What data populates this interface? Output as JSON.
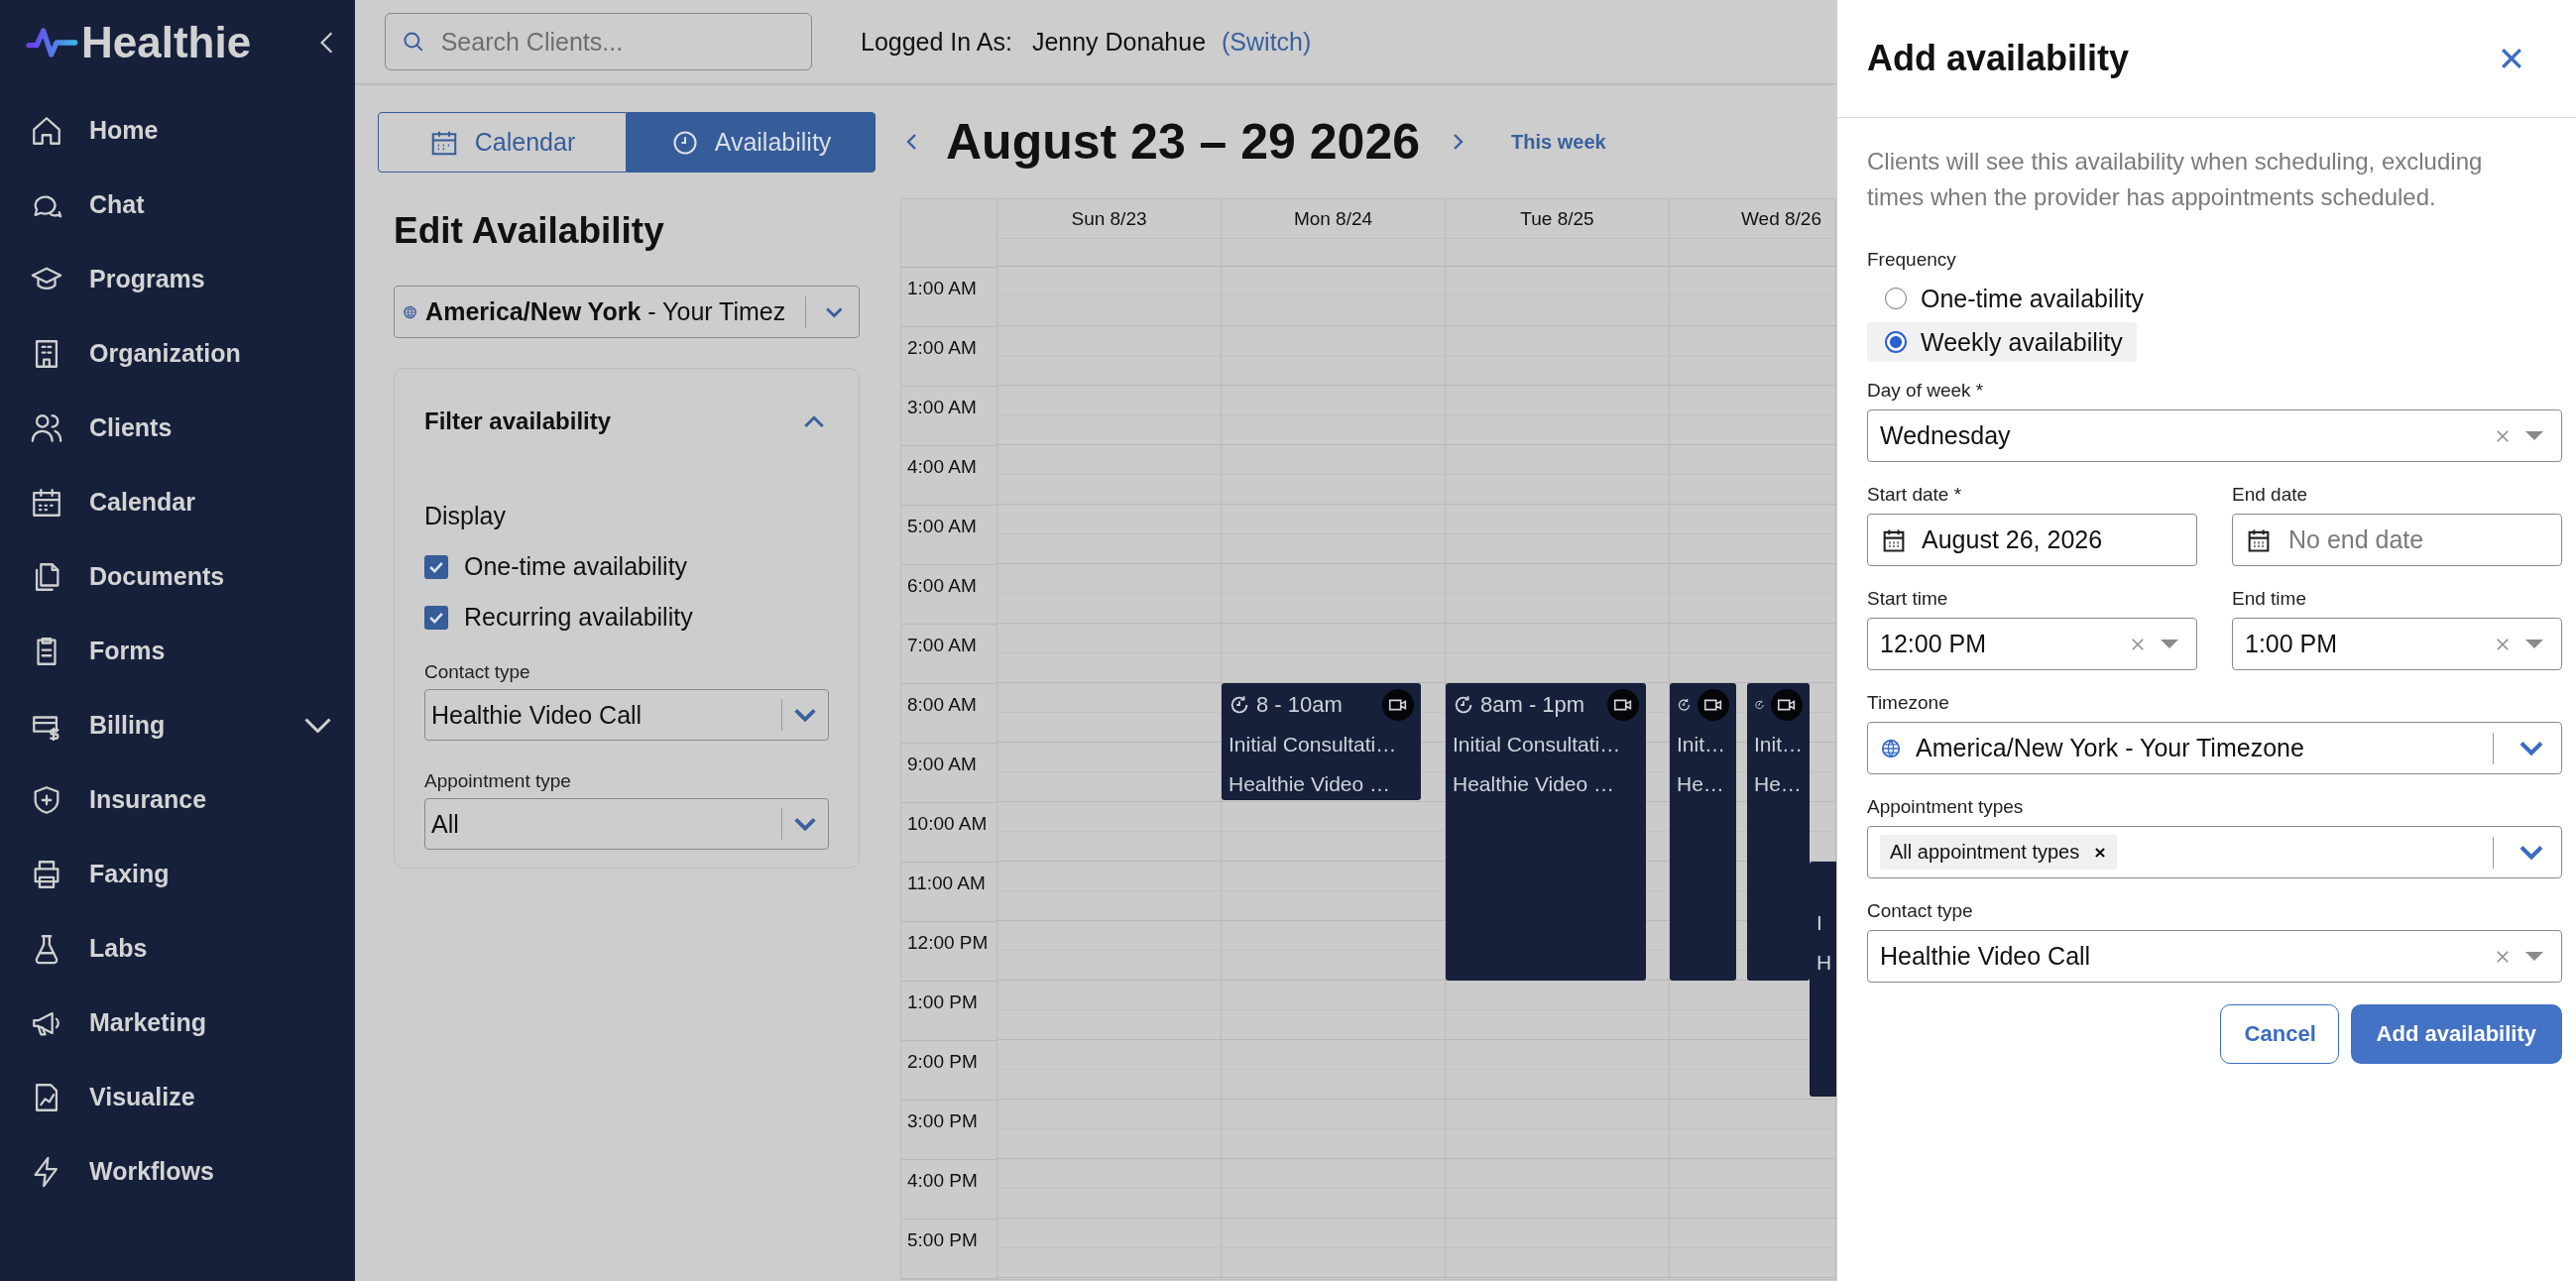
{
  "sidebar": {
    "brand": "Healthie",
    "items": [
      {
        "label": "Home",
        "expandable": false
      },
      {
        "label": "Chat",
        "expandable": false
      },
      {
        "label": "Programs",
        "expandable": false
      },
      {
        "label": "Organization",
        "expandable": false
      },
      {
        "label": "Clients",
        "expandable": false
      },
      {
        "label": "Calendar",
        "expandable": false
      },
      {
        "label": "Documents",
        "expandable": false
      },
      {
        "label": "Forms",
        "expandable": false
      },
      {
        "label": "Billing",
        "expandable": true
      },
      {
        "label": "Insurance",
        "expandable": false
      },
      {
        "label": "Faxing",
        "expandable": false
      },
      {
        "label": "Labs",
        "expandable": false
      },
      {
        "label": "Marketing",
        "expandable": false
      },
      {
        "label": "Visualize",
        "expandable": false
      },
      {
        "label": "Workflows",
        "expandable": false
      }
    ]
  },
  "header": {
    "search": {
      "placeholder": "Search Clients..."
    },
    "logged_in_label": "Logged In As:",
    "user": "Jenny Donahue",
    "switch_link": "(Switch)"
  },
  "view_tabs": [
    {
      "label": "Calendar",
      "selected": false
    },
    {
      "label": "Availability",
      "selected": true
    }
  ],
  "edit_panel": {
    "title": "Edit Availability",
    "timezone": "**America/New York** - Your Timez",
    "filter": {
      "title": "Filter availability",
      "expanded": true,
      "display_label": "Display",
      "checkboxes": [
        {
          "label": "One-time availability",
          "checked": true
        },
        {
          "label": "Recurring availability",
          "checked": true
        }
      ],
      "selects": [
        {
          "label": "Contact type",
          "value": "Healthie Video Call"
        },
        {
          "label": "Appointment type",
          "value": "All"
        }
      ]
    }
  },
  "calendar": {
    "title": "August 23 – 29 2026",
    "this_week": "This week",
    "hours": [
      "1:00 AM",
      "2:00 AM",
      "3:00 AM",
      "4:00 AM",
      "5:00 AM",
      "6:00 AM",
      "7:00 AM",
      "8:00 AM",
      "9:00 AM",
      "10:00 AM",
      "11:00 AM",
      "12:00 PM",
      "1:00 PM",
      "2:00 PM",
      "3:00 PM",
      "4:00 PM",
      "5:00 PM"
    ],
    "days": [
      {
        "label": "Sun 8/23"
      },
      {
        "label": "Mon 8/24",
        "events": [
          {
            "time": "8 - 10am",
            "title": "Initial Consultati…",
            "contact": "Healthie Video …",
            "icons": true
          }
        ]
      },
      {
        "label": "Tue 8/25",
        "events": [
          {
            "time": "8am - 1pm",
            "title": "Initial Consultati…",
            "contact": "Healthie Video …",
            "icons": true
          }
        ]
      },
      {
        "label": "Wed 8/26",
        "events": [
          {
            "title": "Init…",
            "contact": "He…",
            "icons": true
          },
          {
            "title": "Init…",
            "contact": "He…",
            "icons": true
          },
          {
            "title": "I",
            "contact": "H",
            "icons": false
          }
        ]
      }
    ]
  },
  "add_panel": {
    "title": "Add availability",
    "description": "Clients will see this availability when scheduling, excluding times when the provider has appointments scheduled.",
    "frequency": {
      "label": "Frequency",
      "options": [
        {
          "label": "One-time availability",
          "selected": false
        },
        {
          "label": "Weekly availability",
          "selected": true
        }
      ]
    },
    "rows": [
      {
        "fields": [
          {
            "kind": "select",
            "label": "Day of week *",
            "value": "Wednesday"
          }
        ]
      },
      {
        "fields": [
          {
            "kind": "date",
            "label": "Start date *",
            "value": "August 26, 2026"
          },
          {
            "kind": "date",
            "label": "End date",
            "placeholder": "No end date"
          }
        ]
      },
      {
        "fields": [
          {
            "kind": "select",
            "label": "Start time",
            "value": "12:00 PM"
          },
          {
            "kind": "select",
            "label": "End time",
            "value": "1:00 PM"
          }
        ]
      },
      {
        "fields": [
          {
            "kind": "timezone",
            "label": "Timezone",
            "value": "America/New York - Your Timezone"
          }
        ]
      },
      {
        "fields": [
          {
            "kind": "tags",
            "label": "Appointment types",
            "tags": [
              "All appointment types"
            ]
          }
        ]
      },
      {
        "fields": [
          {
            "kind": "select",
            "label": "Contact type",
            "value": "Healthie Video Call"
          }
        ]
      }
    ],
    "buttons": [
      {
        "label": "Cancel",
        "kind": "secondary"
      },
      {
        "label": "Add availability",
        "kind": "primary"
      }
    ]
  }
}
